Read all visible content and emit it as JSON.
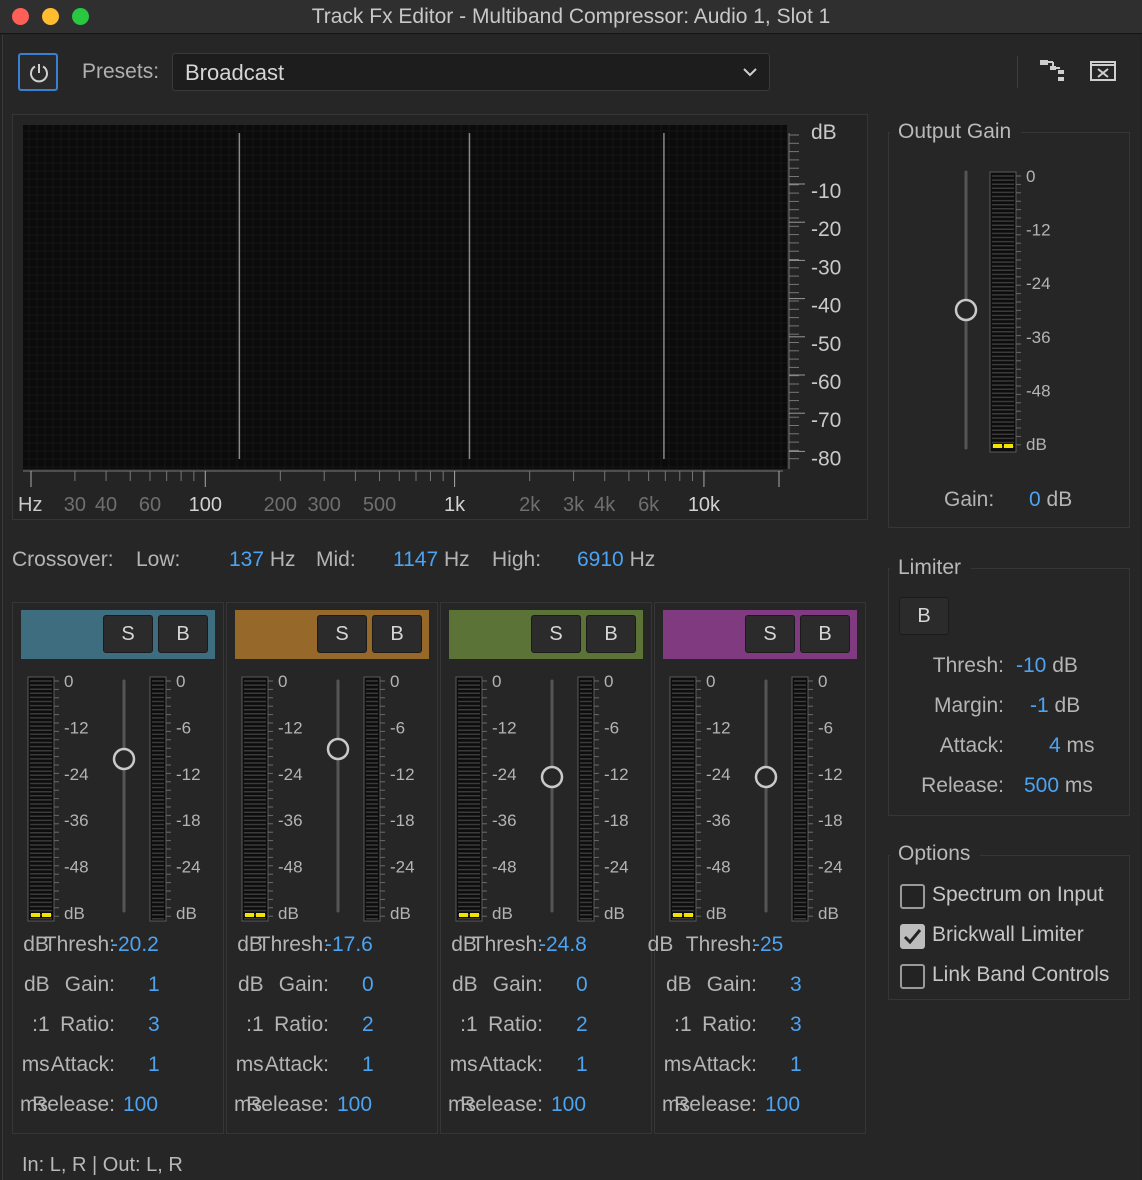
{
  "window": {
    "title": "Track Fx Editor - Multiband Compressor: Audio 1, Slot 1"
  },
  "toolbar": {
    "presets_label": "Presets:",
    "preset_value": "Broadcast",
    "icons": {
      "power": "power-icon",
      "routing": "routing-icon",
      "close_panel": "close-panel-icon",
      "chevron": "chevron-down-icon"
    }
  },
  "spectrum": {
    "db_unit": "dB",
    "db_ticks": [
      "-10",
      "-20",
      "-30",
      "-40",
      "-50",
      "-60",
      "-70",
      "-80"
    ],
    "hz_unit": "Hz",
    "hz_ticks_minor": [
      "30",
      "40",
      "60",
      "200",
      "300",
      "500",
      "2k",
      "3k",
      "4k",
      "6k"
    ],
    "hz_ticks_major": [
      "100",
      "1k",
      "10k"
    ],
    "crossover_lines_hz": [
      137,
      1147,
      6910
    ]
  },
  "output_gain": {
    "title": "Output Gain",
    "meter_ticks": [
      "0",
      "-12",
      "-24",
      "-36",
      "-48",
      "dB"
    ],
    "gain_label": "Gain:",
    "gain_value": "0",
    "gain_unit": "dB"
  },
  "crossover": {
    "label": "Crossover:",
    "low_label": "Low:",
    "low_value": "137",
    "low_unit": "Hz",
    "mid_label": "Mid:",
    "mid_value": "1147",
    "mid_unit": "Hz",
    "high_label": "High:",
    "high_value": "6910",
    "high_unit": "Hz"
  },
  "bands": [
    {
      "color": "#3f6d80",
      "solo": "S",
      "bypass": "B",
      "in_ticks": [
        "0",
        "-12",
        "-24",
        "-36",
        "-48",
        "dB"
      ],
      "gr_ticks": [
        "0",
        "-6",
        "-12",
        "-18",
        "-24",
        "dB"
      ],
      "thresh_label": "Thresh:",
      "thresh": "-20.2",
      "thresh_unit": "dB",
      "gain_label": "Gain:",
      "gain": "1",
      "gain_unit": "dB",
      "ratio_label": "Ratio:",
      "ratio": "3",
      "ratio_unit": ":1",
      "attack_label": "Attack:",
      "attack": "1",
      "attack_unit": "ms",
      "release_label": "Release:",
      "release": "100",
      "release_unit": "ms"
    },
    {
      "color": "#96692a",
      "solo": "S",
      "bypass": "B",
      "in_ticks": [
        "0",
        "-12",
        "-24",
        "-36",
        "-48",
        "dB"
      ],
      "gr_ticks": [
        "0",
        "-6",
        "-12",
        "-18",
        "-24",
        "dB"
      ],
      "thresh_label": "Thresh:",
      "thresh": "-17.6",
      "thresh_unit": "dB",
      "gain_label": "Gain:",
      "gain": "0",
      "gain_unit": "dB",
      "ratio_label": "Ratio:",
      "ratio": "2",
      "ratio_unit": ":1",
      "attack_label": "Attack:",
      "attack": "1",
      "attack_unit": "ms",
      "release_label": "Release:",
      "release": "100",
      "release_unit": "ms"
    },
    {
      "color": "#5c7337",
      "solo": "S",
      "bypass": "B",
      "in_ticks": [
        "0",
        "-12",
        "-24",
        "-36",
        "-48",
        "dB"
      ],
      "gr_ticks": [
        "0",
        "-6",
        "-12",
        "-18",
        "-24",
        "dB"
      ],
      "thresh_label": "Thresh:",
      "thresh": "-24.8",
      "thresh_unit": "dB",
      "gain_label": "Gain:",
      "gain": "0",
      "gain_unit": "dB",
      "ratio_label": "Ratio:",
      "ratio": "2",
      "ratio_unit": ":1",
      "attack_label": "Attack:",
      "attack": "1",
      "attack_unit": "ms",
      "release_label": "Release:",
      "release": "100",
      "release_unit": "ms"
    },
    {
      "color": "#7f3a80",
      "solo": "S",
      "bypass": "B",
      "in_ticks": [
        "0",
        "-12",
        "-24",
        "-36",
        "-48",
        "dB"
      ],
      "gr_ticks": [
        "0",
        "-6",
        "-12",
        "-18",
        "-24",
        "dB"
      ],
      "thresh_label": "Thresh:",
      "thresh": "-25",
      "thresh_unit": "dB",
      "gain_label": "Gain:",
      "gain": "3",
      "gain_unit": "dB",
      "ratio_label": "Ratio:",
      "ratio": "3",
      "ratio_unit": ":1",
      "attack_label": "Attack:",
      "attack": "1",
      "attack_unit": "ms",
      "release_label": "Release:",
      "release": "100",
      "release_unit": "ms"
    }
  ],
  "limiter": {
    "title": "Limiter",
    "bypass": "B",
    "thresh_label": "Thresh:",
    "thresh": "-10",
    "thresh_unit": "dB",
    "margin_label": "Margin:",
    "margin": "-1",
    "margin_unit": "dB",
    "attack_label": "Attack:",
    "attack": "4",
    "attack_unit": "ms",
    "release_label": "Release:",
    "release": "500",
    "release_unit": "ms"
  },
  "options": {
    "title": "Options",
    "items": [
      {
        "label": "Spectrum on Input",
        "checked": false
      },
      {
        "label": "Brickwall Limiter",
        "checked": true
      },
      {
        "label": "Link Band Controls",
        "checked": false
      }
    ]
  },
  "status": {
    "io": "In: L, R | Out: L, R"
  },
  "colors": {
    "accent": "#4ba3f2",
    "meter_led": "#f2e200",
    "panel": "#262626"
  }
}
